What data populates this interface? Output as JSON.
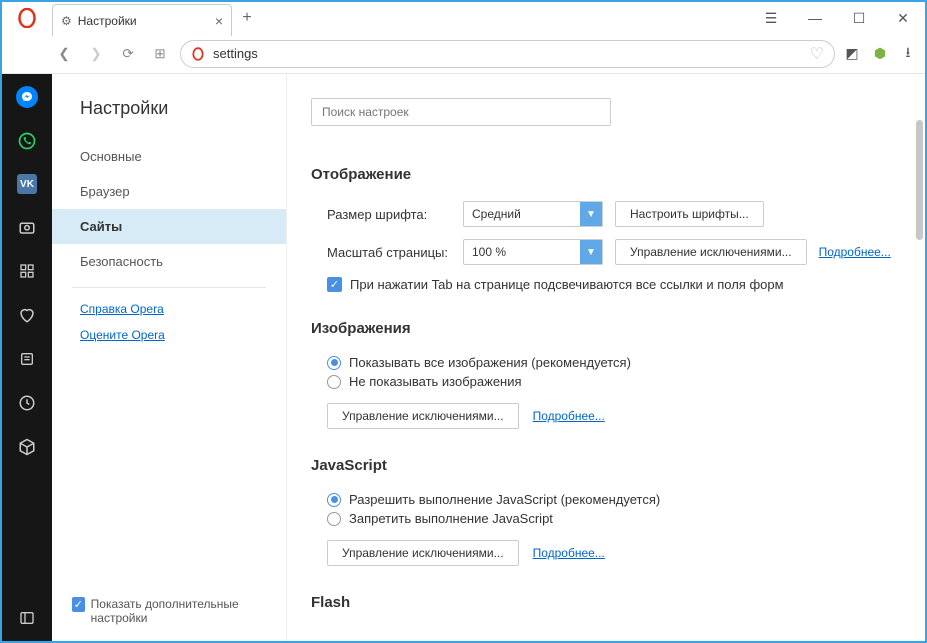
{
  "tab": {
    "title": "Настройки"
  },
  "addr": {
    "value": "settings"
  },
  "sidebar": {
    "title": "Настройки",
    "items": [
      "Основные",
      "Браузер",
      "Сайты",
      "Безопасность"
    ],
    "help": "Справка Opera",
    "rate": "Оцените Opera",
    "advanced": "Показать дополнительные настройки"
  },
  "search": {
    "placeholder": "Поиск настроек"
  },
  "display": {
    "heading": "Отображение",
    "font_label": "Размер шрифта:",
    "font_value": "Средний",
    "font_btn": "Настроить шрифты...",
    "zoom_label": "Масштаб страницы:",
    "zoom_value": "100 %",
    "zoom_btn": "Управление исключениями...",
    "zoom_more": "Подробнее...",
    "tab_check": "При нажатии Tab на странице подсвечиваются все ссылки и поля форм"
  },
  "images": {
    "heading": "Изображения",
    "opt1": "Показывать все изображения (рекомендуется)",
    "opt2": "Не показывать изображения",
    "btn": "Управление исключениями...",
    "more": "Подробнее..."
  },
  "js": {
    "heading": "JavaScript",
    "opt1": "Разрешить выполнение JavaScript (рекомендуется)",
    "opt2": "Запретить выполнение JavaScript",
    "btn": "Управление исключениями...",
    "more": "Подробнее..."
  },
  "flash": {
    "heading": "Flash"
  }
}
